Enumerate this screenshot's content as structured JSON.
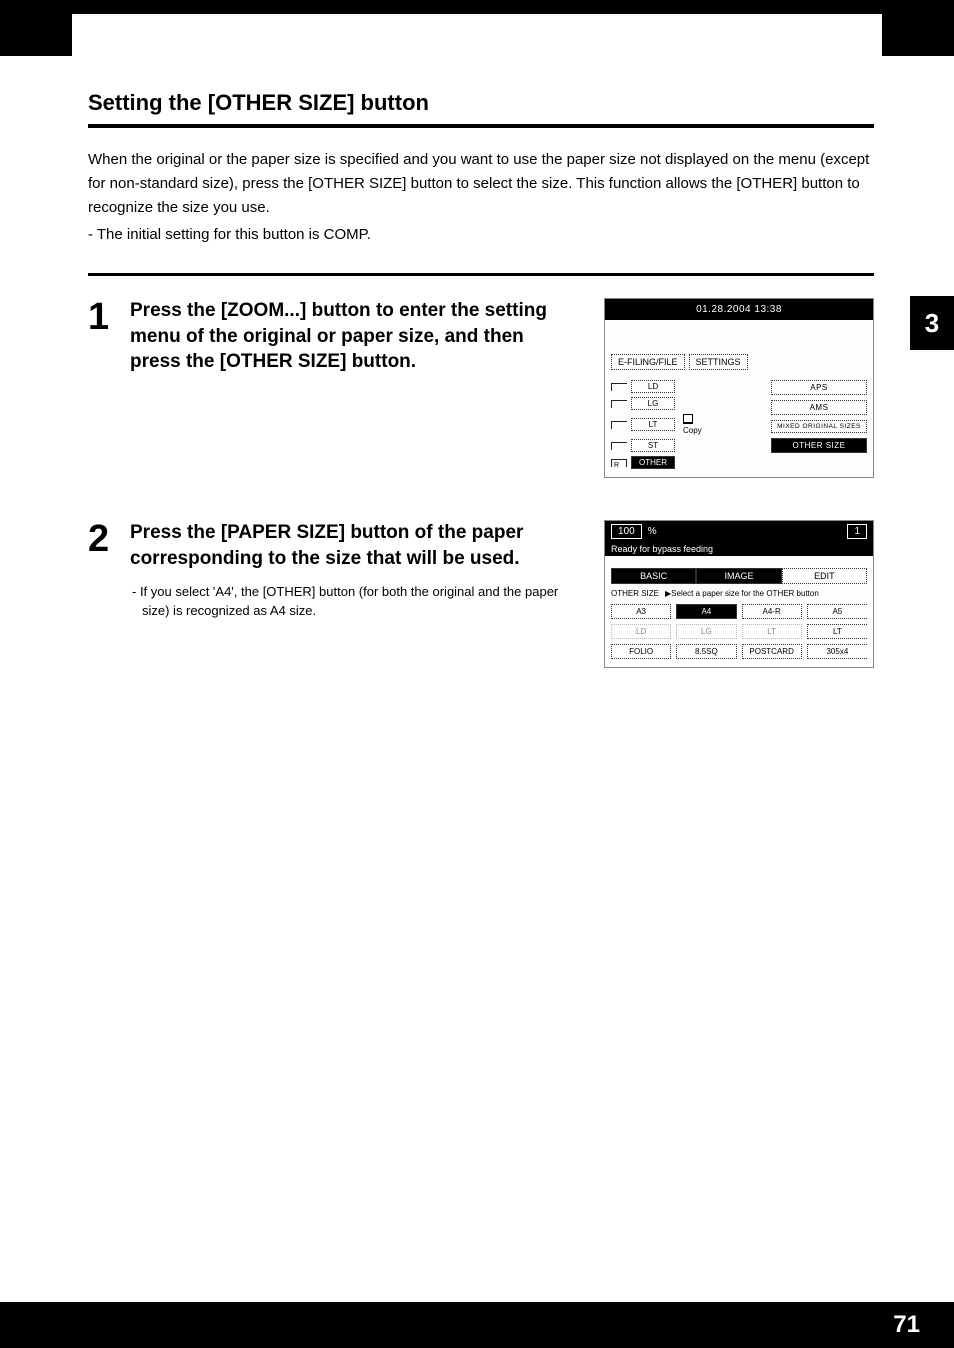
{
  "section_title": "Setting the [OTHER SIZE] button",
  "intro_text": "When the original or the paper size is specified and you want to use the paper size not displayed on the menu (except for non-standard size), press the [OTHER SIZE] button to select the size. This function allows the [OTHER] button to recognize the size you use.",
  "intro_note": "-  The initial setting for this button is COMP.",
  "side_tab": "3",
  "page_number": "71",
  "steps": {
    "s1": {
      "num": "1",
      "heading": "Press the [ZOOM...] button to enter the setting menu of the original or paper size, and then press the [OTHER SIZE] button."
    },
    "s2": {
      "num": "2",
      "heading": "Press the [PAPER SIZE] button of the paper corresponding to the size that will be used.",
      "sub": "-  If you select 'A4', the [OTHER] button (for both the original and the paper size) is recognized as A4 size."
    }
  },
  "screenshot1": {
    "datetime": "01.28.2004 13:38",
    "tabs": {
      "efiling": "E-FILING/FILE",
      "settings": "SETTINGS"
    },
    "left_options": {
      "ld": "LD",
      "lg": "LG",
      "lt": "LT",
      "st": "ST",
      "other": "OTHER"
    },
    "copy_label": "Copy",
    "tray_r_label": "R",
    "right_options": {
      "aps": "APS",
      "ams": "AMS",
      "mixed": "MIXED ORIGINAL SIZES",
      "other_size": "OTHER SIZE"
    }
  },
  "screenshot2": {
    "zoom": "100",
    "percent": "%",
    "count": "1",
    "status": "Ready for bypass feeding",
    "tabs": {
      "basic": "BASIC",
      "image": "IMAGE",
      "edit": "EDIT"
    },
    "hint_label": "OTHER SIZE",
    "hint_text": "Select a paper size for the OTHER button",
    "sizes": {
      "a3": "A3",
      "a4": "A4",
      "a4r": "A4-R",
      "a5": "A5",
      "ld": "LD",
      "lg": "LG",
      "lt": "LT",
      "ltr": "LT",
      "folio": "FOLIO",
      "sq": "8.5SQ",
      "postcard": "POSTCARD",
      "x305": "305x4"
    }
  }
}
